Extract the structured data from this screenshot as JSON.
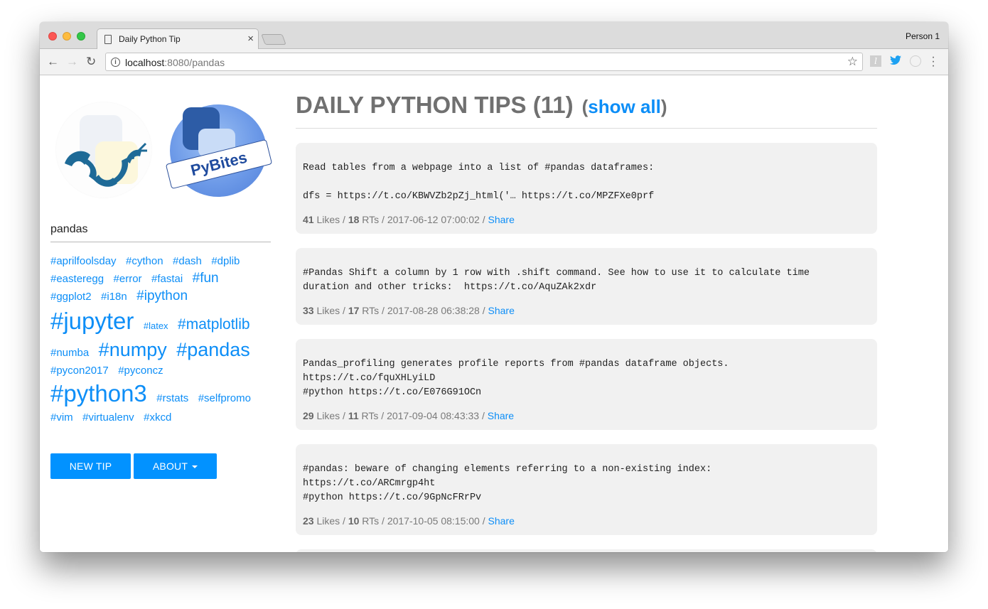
{
  "browser": {
    "tab_title": "Daily Python Tip",
    "tab_close": "×",
    "profile": "Person 1",
    "url_host": "localhost",
    "url_rest": ":8080/pandas",
    "icons": {
      "back": "←",
      "forward": "→",
      "reload": "↻",
      "info": "i",
      "star": "☆",
      "ext1": "l",
      "ext2": "🐦",
      "menu": "⋮"
    }
  },
  "sidebar": {
    "logo_pybites_text": "PyBites",
    "search_value": "pandas",
    "tags": [
      {
        "label": "#aprilfoolsday",
        "size": 15
      },
      {
        "label": "#cython",
        "size": 15
      },
      {
        "label": "#dash",
        "size": 15
      },
      {
        "label": "#dplib",
        "size": 15
      },
      {
        "label": "#easteregg",
        "size": 15
      },
      {
        "label": "#error",
        "size": 15
      },
      {
        "label": "#fastai",
        "size": 15
      },
      {
        "label": "#fun",
        "size": 19
      },
      {
        "label": "#ggplot2",
        "size": 15
      },
      {
        "label": "#i18n",
        "size": 15
      },
      {
        "label": "#ipython",
        "size": 19
      },
      {
        "label": "#jupyter",
        "size": 33
      },
      {
        "label": "#latex",
        "size": 13
      },
      {
        "label": "#matplotlib",
        "size": 21
      },
      {
        "label": "#numba",
        "size": 15
      },
      {
        "label": "#numpy",
        "size": 27
      },
      {
        "label": "#pandas",
        "size": 27
      },
      {
        "label": "#pycon2017",
        "size": 15
      },
      {
        "label": "#pyconcz",
        "size": 15
      },
      {
        "label": "#python3",
        "size": 33
      },
      {
        "label": "#rstats",
        "size": 15
      },
      {
        "label": "#selfpromo",
        "size": 15
      },
      {
        "label": "#vim",
        "size": 15
      },
      {
        "label": "#virtualenv",
        "size": 15
      },
      {
        "label": "#xkcd",
        "size": 15
      }
    ],
    "new_tip_label": "NEW TIP",
    "about_label": "ABOUT"
  },
  "main": {
    "title": "DAILY PYTHON TIPS (11)",
    "open_paren": "(",
    "show_all": "show all",
    "close_paren": ")",
    "tips": [
      {
        "body": "Read tables from a webpage into a list of #pandas dataframes:\n\ndfs = https://t.co/KBWVZb2pZj_html('… https://t.co/MPZFXe0prf",
        "likes": "41",
        "likes_label": " Likes / ",
        "rts": "18",
        "rts_label": " RTs / ",
        "timestamp": "2017-06-12 07:00:02",
        "sep": " / ",
        "share": "Share"
      },
      {
        "body": "#Pandas Shift a column by 1 row with .shift command. See how to use it to calculate time\nduration and other tricks:  https://t.co/AquZAk2xdr",
        "likes": "33",
        "likes_label": " Likes / ",
        "rts": "17",
        "rts_label": " RTs / ",
        "timestamp": "2017-08-28 06:38:28",
        "sep": " / ",
        "share": "Share"
      },
      {
        "body": "Pandas_profiling generates profile reports from #pandas dataframe objects.\nhttps://t.co/fquXHLyiLD\n#python https://t.co/E076G91OCn",
        "likes": "29",
        "likes_label": " Likes / ",
        "rts": "11",
        "rts_label": " RTs / ",
        "timestamp": "2017-09-04 08:43:33",
        "sep": " / ",
        "share": "Share"
      },
      {
        "body": "#pandas: beware of changing elements referring to a non-existing index:\nhttps://t.co/ARCmrgp4ht\n#python https://t.co/9GpNcFRrPv",
        "likes": "23",
        "likes_label": " Likes / ",
        "rts": "10",
        "rts_label": " RTs / ",
        "timestamp": "2017-10-05 08:15:00",
        "sep": " / ",
        "share": "Share"
      }
    ]
  },
  "colors": {
    "accent": "#0292ff",
    "link": "#0d8ef7",
    "card_bg": "#f1f1f1",
    "heading": "#707070"
  }
}
